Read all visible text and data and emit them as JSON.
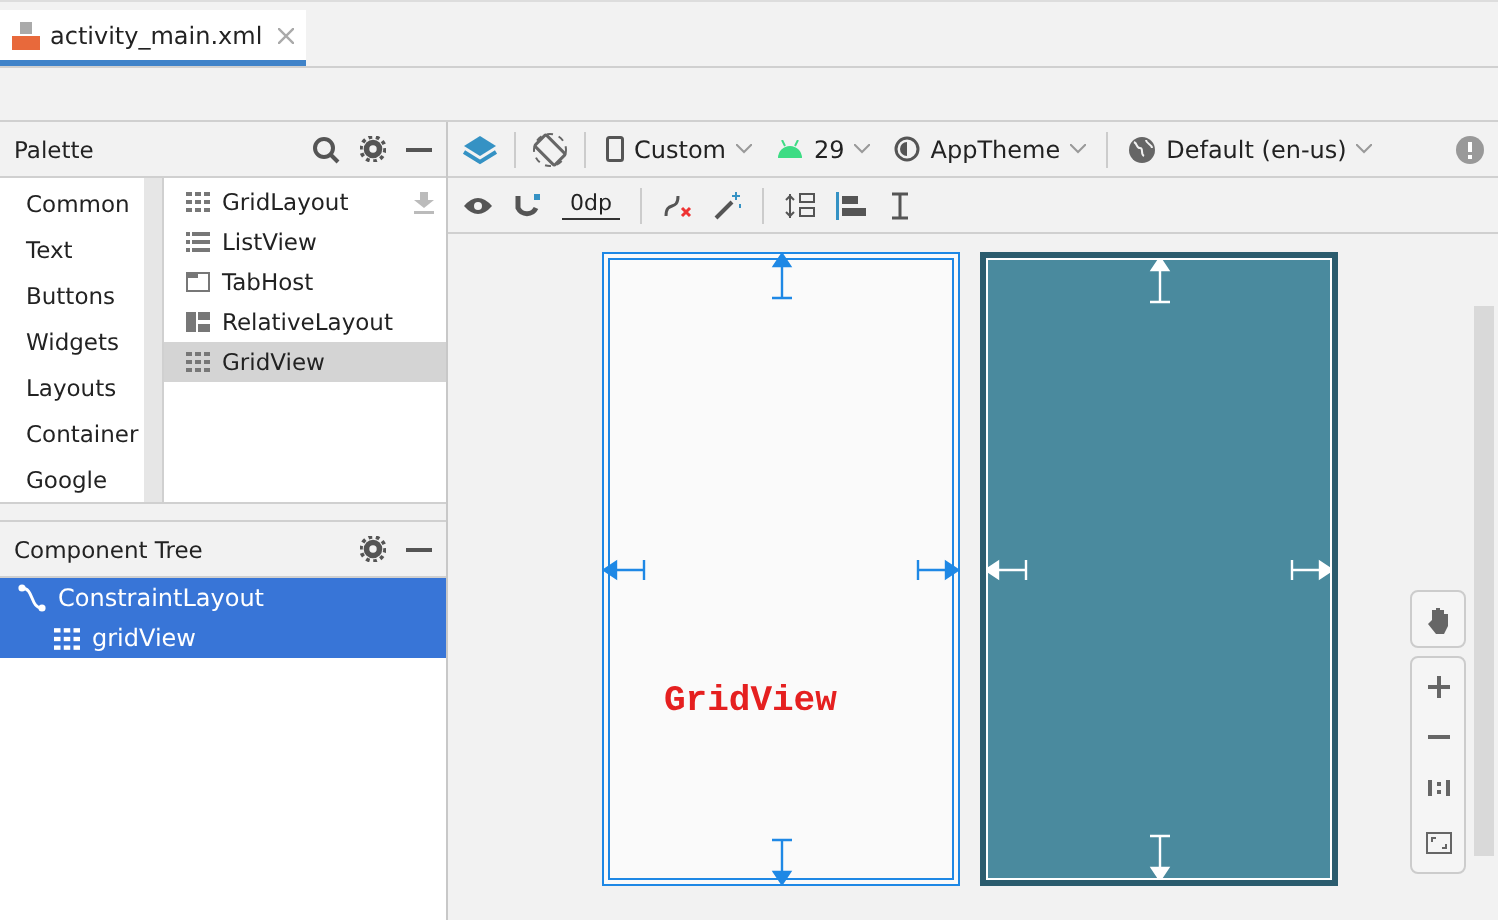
{
  "editor_tabs": [
    {
      "label": "activity_main.xml",
      "selected": true
    }
  ],
  "palette": {
    "title": "Palette",
    "categories": [
      {
        "label": "Common",
        "selected": false
      },
      {
        "label": "Text",
        "selected": false
      },
      {
        "label": "Buttons",
        "selected": false
      },
      {
        "label": "Widgets",
        "selected": false
      },
      {
        "label": "Layouts",
        "selected": false
      },
      {
        "label": "Container",
        "selected": false
      },
      {
        "label": "Google",
        "selected": false
      }
    ],
    "items": [
      {
        "label": "GridLayout",
        "kind": "grid",
        "selected": false
      },
      {
        "label": "ListView",
        "kind": "list",
        "selected": false
      },
      {
        "label": "TabHost",
        "kind": "tabs",
        "selected": false
      },
      {
        "label": "RelativeLayout",
        "kind": "relative",
        "selected": false
      },
      {
        "label": "GridView",
        "kind": "grid",
        "selected": true
      }
    ]
  },
  "component_tree": {
    "title": "Component Tree",
    "nodes": [
      {
        "label": "ConstraintLayout",
        "kind": "constraint",
        "selected": true,
        "children": [
          {
            "label": "gridView",
            "kind": "grid",
            "selected": true
          }
        ]
      }
    ]
  },
  "toolbar": {
    "device": "Custom",
    "api": "29",
    "theme": "AppTheme",
    "locale": "Default (en-us)",
    "margin": "0dp"
  },
  "design": {
    "widget_text": "GridView"
  }
}
